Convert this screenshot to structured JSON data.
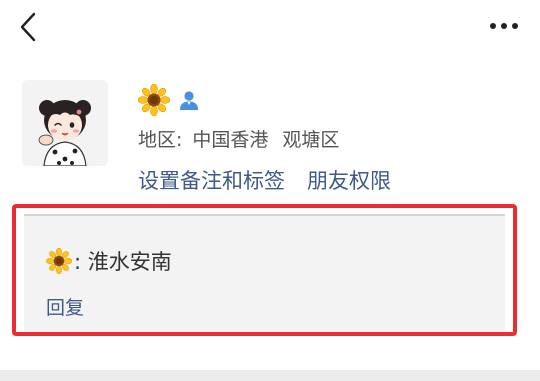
{
  "header": {
    "back_icon": "chevron-left-icon",
    "more_icon": "more-dots-icon"
  },
  "profile": {
    "avatar_icon": "avatar-cartoon-girl",
    "name_icon": "sunflower-icon",
    "badge_icon": "person-icon",
    "region_label": "地区:",
    "region_city": "中国香港",
    "region_district": "观塘区",
    "link_remark": "设置备注和标签",
    "link_permission": "朋友权限"
  },
  "comment": {
    "emoji_icon": "sunflower-icon",
    "text": ": 淮水安南",
    "reply_label": "回复"
  },
  "colors": {
    "accent_link": "#3d5a8a",
    "highlight_border": "#ea2e2e",
    "badge_blue": "#4a90e2"
  }
}
